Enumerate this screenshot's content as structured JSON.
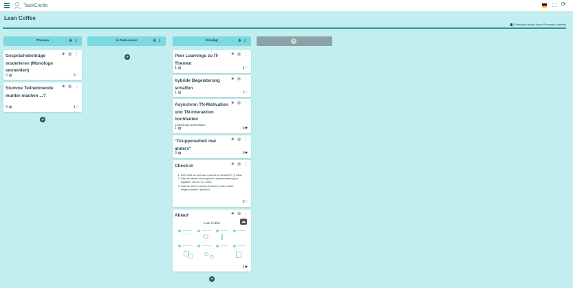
{
  "app": {
    "title": "TaskCards"
  },
  "board": {
    "title": "Lean Coffee",
    "marked_info": "0 Benutzer haben diese Pinnwand markiert"
  },
  "icons": {
    "menu": "hamburger-menu-icon",
    "logo": "taskcards-logo-icon",
    "flag": "german-flag-icon",
    "fullscreen": "fullscreen-icon",
    "refresh": "refresh-icon",
    "move": "move-icon",
    "more": "more-vertical-icon",
    "comment": "comment-icon",
    "heart": "heart-icon",
    "add": "add-icon"
  },
  "colors": {
    "background": "#c2eef0",
    "column_header": "#7dd8e0",
    "add_column": "#8ba3a5",
    "accent": "#2f8f98",
    "add_button": "#1e4f55"
  },
  "columns": [
    {
      "title": "Themen",
      "cards": [
        {
          "title": "Gesprächsbeiträge moderieren (Monologe vermeiden)",
          "comments": "0",
          "votes": "2"
        },
        {
          "title": "Stumme Teilnehmende munter machen ...?",
          "comments": "0",
          "votes": "1"
        }
      ]
    },
    {
      "title": "In Diskussion",
      "cards": []
    },
    {
      "title": "Erledigt",
      "cards": [
        {
          "title": "Peer Learnings zu IT-Themen",
          "comments": "1",
          "votes": "2"
        },
        {
          "title": "hybride Begeisterung schaffen",
          "comments": "1",
          "votes": "3"
        },
        {
          "title": "Asynchron TN-Motivation und TN-Interaktion hochhalten",
          "subtitle": "Endlosfrage-Antwortspiel",
          "comments": "1",
          "votes": "9"
        },
        {
          "title": "\"Gruppenarbeit mal anders\"",
          "comments": "3",
          "votes": "9"
        },
        {
          "title": "Check-in",
          "items": [
            "Wie heißt du und was machst du beruflich? (1 Satz)",
            "Was ist aktuell deine größte Herausforderung im digitalen Lernen? (1 Satz)",
            "Hast du schon einmal an einem Lean Coffee teilgenommen? (ja/nein)"
          ],
          "votes": "0"
        },
        {
          "title": "Ablauf",
          "image_title": "Lean Coffee",
          "votes": "1"
        }
      ]
    }
  ]
}
